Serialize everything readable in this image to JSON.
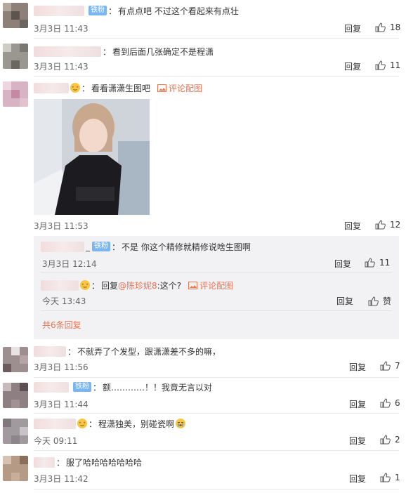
{
  "comments": [
    {
      "badge": "铁粉",
      "text": "有点点吧  不过这个看起来有点壮",
      "time": "3月3日 11:43",
      "reply": "回复",
      "likes": "18"
    },
    {
      "text": "看到后面几张确定不是程潇",
      "time": "3月3日 11:43",
      "reply": "回复",
      "likes": "11"
    },
    {
      "text": "看看潇潇生图吧",
      "pic_link": "评论配图",
      "time": "3月3日 11:53",
      "reply": "回复",
      "likes": "12"
    },
    {
      "badge": "铁粉",
      "text": "不就弄了个发型，跟潇潇差不多的嘛，",
      "time": "3月3日 11:56",
      "reply": "回复",
      "likes": "7"
    },
    {
      "badge": "铁粉",
      "text": "额…………！！我竟无言以对",
      "time": "3月3日 11:44",
      "reply": "回复",
      "likes": "6"
    },
    {
      "text": "程潇独美，别碰瓷啊",
      "time": "今天 09:11",
      "reply": "回复",
      "likes": "2"
    },
    {
      "text": "服了哈哈哈哈哈哈哈",
      "time": "3月3日 11:42",
      "reply": "回复",
      "likes": "1"
    }
  ],
  "subreplies": [
    {
      "prefix": "_",
      "badge": "铁粉",
      "text": "不是 你这个精修就精修说啥生图啊",
      "time": "3月3日 12:14",
      "reply": "回复",
      "likes": "11"
    },
    {
      "reply_prefix": "回复",
      "mention": "@陈珍妮8",
      "text": ":这个?",
      "pic_link": "评论配图",
      "time": "今天 13:43",
      "reply": "回复",
      "likes": "赞"
    }
  ],
  "more_replies": "共6条回复",
  "colors": {
    "accent": "#eb7350",
    "badge": "#7cb6ef",
    "subbox": "#f2f2f5"
  },
  "icons": [
    "thumb-up-icon",
    "image-icon",
    "heart-eyes-emoji",
    "crying-emoji"
  ]
}
